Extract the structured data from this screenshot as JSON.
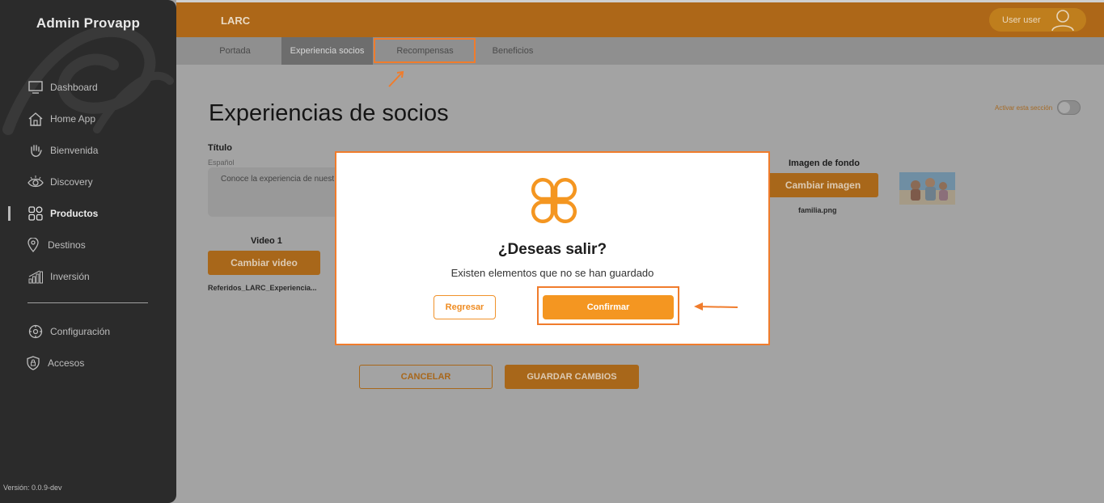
{
  "sidebar": {
    "app_title": "Admin Provapp",
    "items": [
      {
        "label": "Dashboard",
        "icon": "monitor-icon"
      },
      {
        "label": "Home App",
        "icon": "home-icon"
      },
      {
        "label": "Bienvenida",
        "icon": "wave-hand-icon"
      },
      {
        "label": "Discovery",
        "icon": "eye-icon"
      },
      {
        "label": "Productos",
        "icon": "grid-icon",
        "active": true
      },
      {
        "label": "Destinos",
        "icon": "location-pin-icon"
      },
      {
        "label": "Inversión",
        "icon": "bar-chart-icon"
      }
    ],
    "bottom_items": [
      {
        "label": "Configuración",
        "icon": "gear-icon"
      },
      {
        "label": "Accesos",
        "icon": "shield-icon"
      }
    ],
    "version": "Versión: 0.0.9-dev"
  },
  "header": {
    "project": "LARC",
    "user_name": "User user",
    "colors": {
      "header_bg": "#ad6718",
      "accent": "#f49621",
      "highlight": "#f07c2c"
    }
  },
  "tabs": [
    {
      "label": "Portada"
    },
    {
      "label": "Experiencia socios",
      "active": true
    },
    {
      "label": "Recompensas",
      "highlighted": true
    },
    {
      "label": "Beneficios"
    }
  ],
  "main": {
    "title": "Experiencias de socios",
    "toggle_label": "Activar esta sección",
    "toggle_on": false,
    "title_field_label": "Título",
    "lang_label": "Español",
    "title_field_value": "Conoce la experiencia de nuestros socios",
    "video_label": "Video 1",
    "change_video": "Cambiar video",
    "video_file": "Referidos_LARC_Experiencia...",
    "bg_image_label": "Imagen de fondo",
    "change_image": "Cambiar imagen",
    "image_file": "familia.png",
    "cancel": "CANCELAR",
    "save": "GUARDAR CAMBIOS"
  },
  "modal": {
    "logo_icon": "provapp-logo-icon",
    "title": "¿Deseas salir?",
    "message": "Existen elementos que no se han guardado",
    "back": "Regresar",
    "confirm": "Confirmar"
  }
}
